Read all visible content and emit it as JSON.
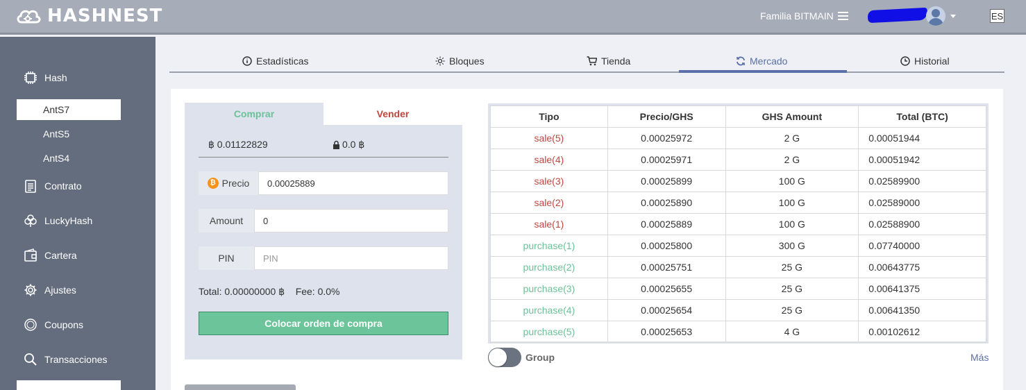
{
  "header": {
    "logo_text": "HASHNEST",
    "account_name": "Familia BITMAIN",
    "language": "ES"
  },
  "sidebar": {
    "items": [
      {
        "label": "Hash",
        "icon": "chip-icon"
      },
      {
        "label": "Contrato",
        "icon": "contract-icon"
      },
      {
        "label": "LuckyHash",
        "icon": "clover-icon"
      },
      {
        "label": "Cartera",
        "icon": "wallet-icon"
      },
      {
        "label": "Ajustes",
        "icon": "gear-icon"
      },
      {
        "label": "Coupons",
        "icon": "coupon-icon"
      },
      {
        "label": "Transacciones",
        "icon": "search-icon"
      }
    ],
    "sub_items": [
      {
        "label": "AntS7",
        "active": true
      },
      {
        "label": "AntS5",
        "active": false
      },
      {
        "label": "AntS4",
        "active": false
      }
    ]
  },
  "tabs": [
    {
      "label": "Estadísticas",
      "icon": "info-icon"
    },
    {
      "label": "Bloques",
      "icon": "sun-icon"
    },
    {
      "label": "Tienda",
      "icon": "cart-icon"
    },
    {
      "label": "Mercado",
      "icon": "refresh-icon",
      "active": true
    },
    {
      "label": "Historial",
      "icon": "clock-icon"
    }
  ],
  "order_form": {
    "buy_tab": "Comprar",
    "sell_tab": "Vender",
    "btc_balance": "฿ 0.01122829",
    "locked_balance": "0.0 ฿",
    "price_label": "Precio",
    "price_value": "0.00025889",
    "amount_label": "Amount",
    "amount_value": "0",
    "pin_label": "PIN",
    "pin_placeholder": "PIN",
    "total_text": "Total: 0.00000000 ฿",
    "fee_text": "Fee: 0.0%",
    "submit_label": "Colocar orden de compra"
  },
  "order_book": {
    "headers": [
      "Tipo",
      "Precio/GHS",
      "GHS Amount",
      "Total (BTC)"
    ],
    "rows": [
      {
        "type": "sale(5)",
        "kind": "sale",
        "price": "0.00025972",
        "amount": "2 G",
        "total": "0.00051944"
      },
      {
        "type": "sale(4)",
        "kind": "sale",
        "price": "0.00025971",
        "amount": "2 G",
        "total": "0.00051942"
      },
      {
        "type": "sale(3)",
        "kind": "sale",
        "price": "0.00025899",
        "amount": "100 G",
        "total": "0.02589900"
      },
      {
        "type": "sale(2)",
        "kind": "sale",
        "price": "0.00025890",
        "amount": "100 G",
        "total": "0.02589000"
      },
      {
        "type": "sale(1)",
        "kind": "sale",
        "price": "0.00025889",
        "amount": "100 G",
        "total": "0.02588900"
      },
      {
        "type": "purchase(1)",
        "kind": "purchase",
        "price": "0.00025800",
        "amount": "300 G",
        "total": "0.07740000"
      },
      {
        "type": "purchase(2)",
        "kind": "purchase",
        "price": "0.00025751",
        "amount": "25 G",
        "total": "0.00643775"
      },
      {
        "type": "purchase(3)",
        "kind": "purchase",
        "price": "0.00025655",
        "amount": "25 G",
        "total": "0.00641375"
      },
      {
        "type": "purchase(4)",
        "kind": "purchase",
        "price": "0.00025654",
        "amount": "25 G",
        "total": "0.00641350"
      },
      {
        "type": "purchase(5)",
        "kind": "purchase",
        "price": "0.00025653",
        "amount": "4 G",
        "total": "0.00102612"
      }
    ],
    "group_label": "Group",
    "group_enabled": false,
    "more_label": "Más"
  },
  "colors": {
    "sale": "#c0473f",
    "purchase": "#6ac29a",
    "accent": "#5b6fa8",
    "sidebar": "#646d7e"
  }
}
